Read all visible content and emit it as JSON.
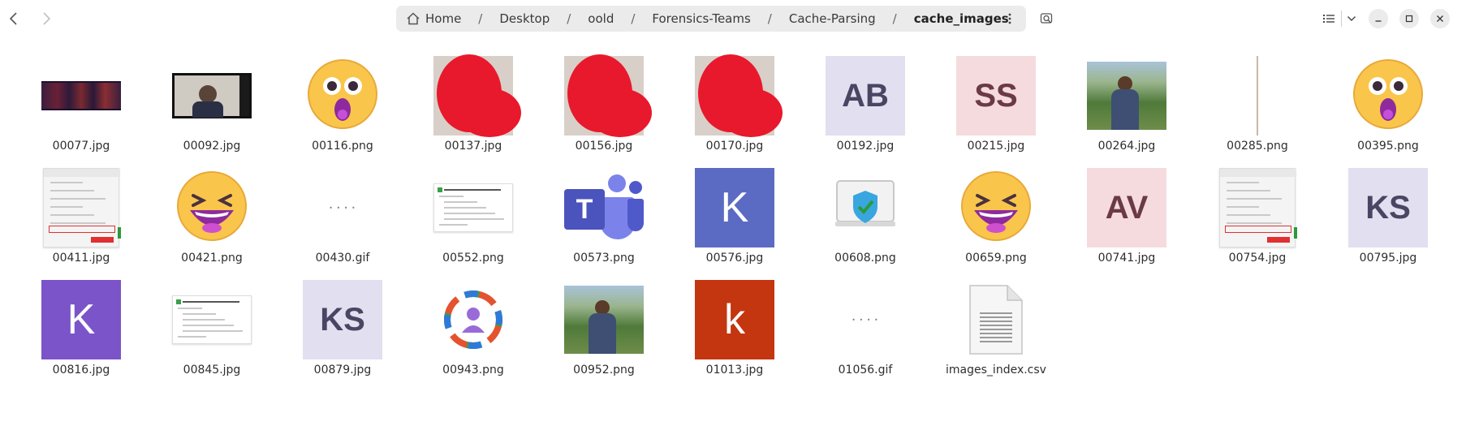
{
  "header": {
    "breadcrumbs": [
      {
        "label": "Home"
      },
      {
        "label": "Desktop"
      },
      {
        "label": "oold"
      },
      {
        "label": "Forensics-Teams"
      },
      {
        "label": "Cache-Parsing"
      },
      {
        "label": "cache_images"
      }
    ],
    "icons": {
      "back": "chevron-left-icon",
      "forward": "chevron-right-icon",
      "home": "home-icon",
      "menu": "vertical-dots-icon",
      "search": "search-icon",
      "list_view": "list-view-icon",
      "view_options": "chevron-down-icon",
      "minimize": "minimize-icon",
      "maximize": "maximize-icon",
      "close": "close-icon"
    }
  },
  "files": [
    {
      "name": "00077.jpg",
      "kind": "spectrogram"
    },
    {
      "name": "00092.jpg",
      "kind": "video-call"
    },
    {
      "name": "00116.png",
      "kind": "emoji-surprised"
    },
    {
      "name": "00137.jpg",
      "kind": "redacted-photo"
    },
    {
      "name": "00156.jpg",
      "kind": "redacted-photo"
    },
    {
      "name": "00170.jpg",
      "kind": "redacted-photo"
    },
    {
      "name": "00192.jpg",
      "kind": "initials",
      "text": "AB",
      "bg": "#e2dff0",
      "fg": "#4a4563"
    },
    {
      "name": "00215.jpg",
      "kind": "initials",
      "text": "SS",
      "bg": "#f5dbde",
      "fg": "#6b3b44"
    },
    {
      "name": "00264.jpg",
      "kind": "landscape-photo"
    },
    {
      "name": "00285.png",
      "kind": "thin-line"
    },
    {
      "name": "00395.png",
      "kind": "emoji-surprised"
    },
    {
      "name": "00411.jpg",
      "kind": "dialog-screenshot"
    },
    {
      "name": "00421.png",
      "kind": "emoji-laughing"
    },
    {
      "name": "00430.gif",
      "kind": "tiny-dots"
    },
    {
      "name": "00552.png",
      "kind": "document-snippet"
    },
    {
      "name": "00573.png",
      "kind": "teams-logo",
      "text": "T"
    },
    {
      "name": "00576.jpg",
      "kind": "initials",
      "text": "K",
      "bg": "#5b6bc4",
      "fg": "#ffffff"
    },
    {
      "name": "00608.png",
      "kind": "shield-device"
    },
    {
      "name": "00659.png",
      "kind": "emoji-laughing"
    },
    {
      "name": "00741.jpg",
      "kind": "initials",
      "text": "AV",
      "bg": "#f5dbde",
      "fg": "#6b3b44"
    },
    {
      "name": "00754.jpg",
      "kind": "dialog-screenshot"
    },
    {
      "name": "00795.jpg",
      "kind": "initials",
      "text": "KS",
      "bg": "#e2dff0",
      "fg": "#4a4563"
    },
    {
      "name": "00816.jpg",
      "kind": "initials",
      "text": "K",
      "bg": "#7b54c9",
      "fg": "#ffffff"
    },
    {
      "name": "00845.jpg",
      "kind": "document-snippet"
    },
    {
      "name": "00879.jpg",
      "kind": "initials",
      "text": "KS",
      "bg": "#e2dff0",
      "fg": "#4a4563"
    },
    {
      "name": "00943.png",
      "kind": "people-ring"
    },
    {
      "name": "00952.png",
      "kind": "landscape-photo"
    },
    {
      "name": "01013.jpg",
      "kind": "initials",
      "text": "k",
      "bg": "#c4360f",
      "fg": "#ffffff"
    },
    {
      "name": "01056.gif",
      "kind": "tiny-dots"
    },
    {
      "name": "images_index.csv",
      "kind": "text-file"
    }
  ]
}
